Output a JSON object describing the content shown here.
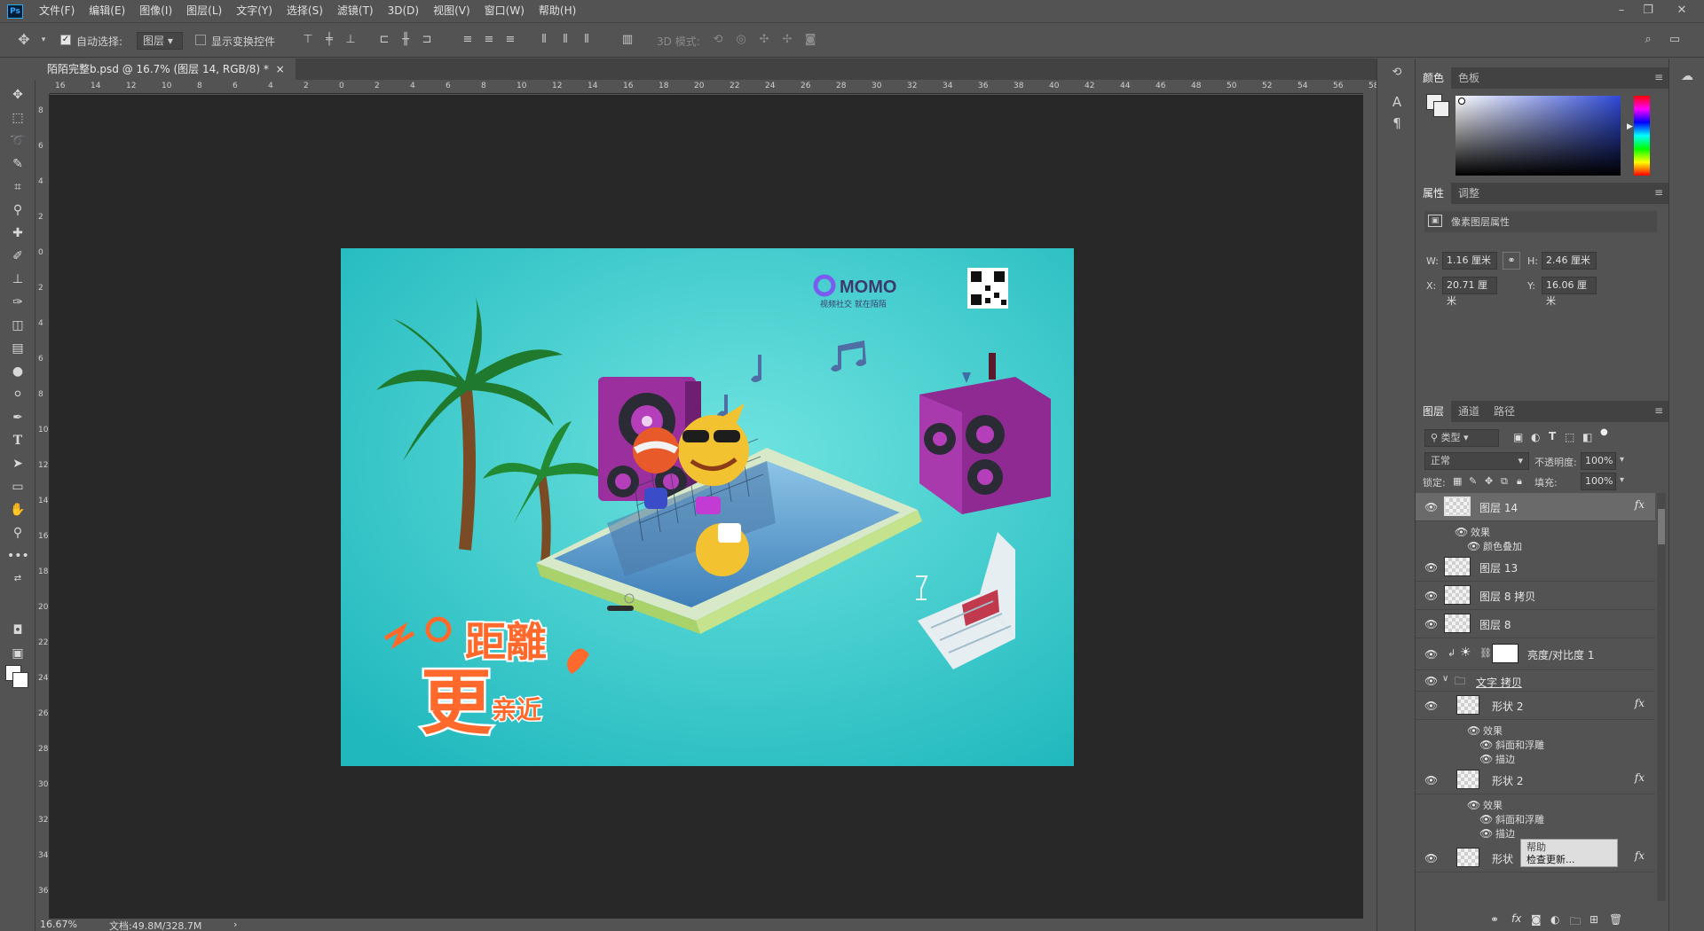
{
  "menu": {
    "items": [
      "文件(F)",
      "编辑(E)",
      "图像(I)",
      "图层(L)",
      "文字(Y)",
      "选择(S)",
      "滤镜(T)",
      "3D(D)",
      "视图(V)",
      "窗口(W)",
      "帮助(H)"
    ]
  },
  "options": {
    "auto_select_label": "自动选择:",
    "auto_select_value": "图层",
    "show_transform_label": "显示变换控件",
    "mode_3d_label": "3D 模式:"
  },
  "document": {
    "tab_title": "陌陌完整b.psd @ 16.7% (图层 14, RGB/8) *",
    "close_glyph": "×"
  },
  "rulers": {
    "top": [
      "16",
      "14",
      "12",
      "10",
      "8",
      "6",
      "4",
      "2",
      "0",
      "2",
      "4",
      "6",
      "8",
      "10",
      "12",
      "14",
      "16",
      "18",
      "20",
      "22",
      "24",
      "26",
      "28",
      "30",
      "32",
      "34",
      "36",
      "38",
      "40",
      "42",
      "44",
      "46",
      "48",
      "50",
      "52",
      "54",
      "56",
      "58"
    ],
    "left": [
      "8",
      "6",
      "4",
      "2",
      "0",
      "2",
      "4",
      "6",
      "8",
      "10",
      "12",
      "14",
      "16",
      "18",
      "20",
      "22",
      "24",
      "26",
      "28",
      "30",
      "32",
      "34",
      "36"
    ]
  },
  "artwork": {
    "brand": "MOMO",
    "tagline": "视频社交 就在陌陌",
    "headline_1": "距離",
    "headline_2": "更",
    "headline_3": "亲近",
    "bg": "#2fc9cc"
  },
  "status": {
    "zoom": "16.67%",
    "doc_size": "文档:49.8M/328.7M",
    "arrow": "›"
  },
  "color_panel": {
    "tab_color": "颜色",
    "tab_swatches": "色板"
  },
  "properties": {
    "tab_props": "属性",
    "tab_adjust": "调整",
    "title": "像素图层属性",
    "w_label": "W:",
    "w_value": "1.16 厘米",
    "h_label": "H:",
    "h_value": "2.46 厘米",
    "x_label": "X:",
    "x_value": "20.71 厘米",
    "y_label": "Y:",
    "y_value": "16.06 厘米"
  },
  "layers_panel": {
    "tab_layers": "图层",
    "tab_channels": "通道",
    "tab_paths": "路径",
    "filter_kind": "类型",
    "blend_mode": "正常",
    "opacity_label": "不透明度:",
    "opacity_value": "100%",
    "lock_label": "锁定:",
    "fill_label": "填充:",
    "fill_value": "100%",
    "rows": {
      "l14": {
        "name": "图层 14",
        "effects": "效果",
        "sub1": "颜色叠加"
      },
      "l13": {
        "name": "图层 13"
      },
      "l8copy": {
        "name": "图层 8 拷贝"
      },
      "l8": {
        "name": "图层 8"
      },
      "bc": {
        "name": "亮度/对比度 1"
      },
      "group": {
        "name": "文字 拷贝"
      },
      "s2a": {
        "name": "形状 2",
        "effects": "效果",
        "sub1": "斜面和浮雕",
        "sub2": "描边"
      },
      "s2b": {
        "name": "形状 2",
        "effects": "效果",
        "sub1": "斜面和浮雕",
        "sub2": "描边"
      },
      "s_last": {
        "name": "形状"
      }
    },
    "fx_label": "fx",
    "tooltip_top": "帮助",
    "tooltip": "检查更新..."
  },
  "colors": {
    "accent": "#31a8ff",
    "ui_bg": "#535353",
    "canvas_bg": "#282828"
  }
}
